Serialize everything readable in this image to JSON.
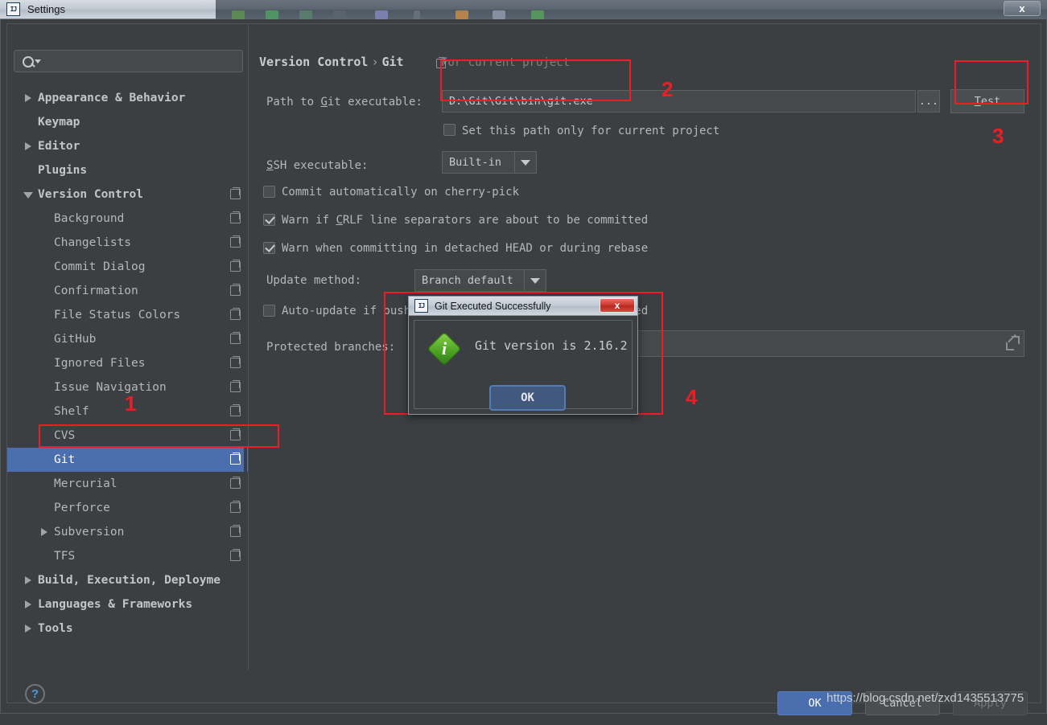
{
  "window": {
    "title": "Settings",
    "app_icon": "IJ",
    "close_label": "x"
  },
  "search": {
    "value": "",
    "placeholder": ""
  },
  "sidebar": {
    "items": [
      {
        "label": "Appearance & Behavior",
        "level": 0,
        "arrow": "collapsed",
        "scope_icon": false
      },
      {
        "label": "Keymap",
        "level": 0,
        "arrow": "none",
        "scope_icon": false
      },
      {
        "label": "Editor",
        "level": 0,
        "arrow": "collapsed",
        "scope_icon": false
      },
      {
        "label": "Plugins",
        "level": 0,
        "arrow": "none",
        "scope_icon": false
      },
      {
        "label": "Version Control",
        "level": 0,
        "arrow": "expanded",
        "scope_icon": true
      },
      {
        "label": "Background",
        "level": 1,
        "arrow": "none",
        "scope_icon": true
      },
      {
        "label": "Changelists",
        "level": 1,
        "arrow": "none",
        "scope_icon": true
      },
      {
        "label": "Commit Dialog",
        "level": 1,
        "arrow": "none",
        "scope_icon": true
      },
      {
        "label": "Confirmation",
        "level": 1,
        "arrow": "none",
        "scope_icon": true
      },
      {
        "label": "File Status Colors",
        "level": 1,
        "arrow": "none",
        "scope_icon": true
      },
      {
        "label": "GitHub",
        "level": 1,
        "arrow": "none",
        "scope_icon": true
      },
      {
        "label": "Ignored Files",
        "level": 1,
        "arrow": "none",
        "scope_icon": true
      },
      {
        "label": "Issue Navigation",
        "level": 1,
        "arrow": "none",
        "scope_icon": true
      },
      {
        "label": "Shelf",
        "level": 1,
        "arrow": "none",
        "scope_icon": true
      },
      {
        "label": "CVS",
        "level": 1,
        "arrow": "none",
        "scope_icon": true
      },
      {
        "label": "Git",
        "level": 1,
        "arrow": "none",
        "scope_icon": true,
        "selected": true
      },
      {
        "label": "Mercurial",
        "level": 1,
        "arrow": "none",
        "scope_icon": true
      },
      {
        "label": "Perforce",
        "level": 1,
        "arrow": "none",
        "scope_icon": true
      },
      {
        "label": "Subversion",
        "level": 1,
        "arrow": "collapsed",
        "scope_icon": true
      },
      {
        "label": "TFS",
        "level": 1,
        "arrow": "none",
        "scope_icon": true
      },
      {
        "label": "Build, Execution, Deployme",
        "level": 0,
        "arrow": "collapsed",
        "scope_icon": false
      },
      {
        "label": "Languages & Frameworks",
        "level": 0,
        "arrow": "collapsed",
        "scope_icon": false
      },
      {
        "label": "Tools",
        "level": 0,
        "arrow": "collapsed",
        "scope_icon": false
      }
    ]
  },
  "pane": {
    "breadcrumb_root": "Version Control",
    "breadcrumb_sep": "›",
    "breadcrumb_leaf": "Git",
    "scope_note": "For current project",
    "path_label_pre": "Path to ",
    "path_label_accel": "G",
    "path_label_post": "it executable:",
    "path_value": "D:\\Git\\Git\\bin\\git.exe",
    "browse_label": "...",
    "test_label_accel": "T",
    "test_label_rest": "est",
    "set_path_checkbox_label": "Set this path only for current project",
    "set_path_checked": false,
    "ssh_label_accel": "S",
    "ssh_label_rest": "SH executable:",
    "ssh_value": "Built-in",
    "cherry_pick_label": "Commit automatically on cherry-pick",
    "cherry_pick_checked": false,
    "crlf_label_pre": "Warn if ",
    "crlf_label_accel": "C",
    "crlf_label_post": "RLF line separators are about to be committed",
    "crlf_checked": true,
    "detached_label": "Warn when committing in detached HEAD or during rebase",
    "detached_checked": true,
    "update_method_label": "Update method:",
    "update_method_value": "Branch default",
    "auto_update_label": "Auto-update if push of the current branch was rejected",
    "auto_update_checked": false,
    "protected_branches_label": "Protected branches:",
    "protected_branches_value": ""
  },
  "dialog": {
    "icon": "IJ",
    "title": "Git Executed Successfully",
    "close_label": "x",
    "message": "Git version is 2.16.2",
    "ok_label": "OK",
    "info_glyph": "i"
  },
  "footer": {
    "help_label": "?",
    "ok_label": "OK",
    "cancel_label": "Cancel",
    "apply_label": "Apply",
    "watermark": "https://blog.csdn.net/zxd1435513775"
  },
  "annotations": [
    {
      "number": "1"
    },
    {
      "number": "2"
    },
    {
      "number": "3"
    },
    {
      "number": "4"
    }
  ],
  "colors": {
    "accent_blue": "#4b6eaf",
    "annotation_red": "#ee1c25",
    "background": "#3c3f41",
    "field": "#45494a",
    "success_green": "#4ea524"
  }
}
